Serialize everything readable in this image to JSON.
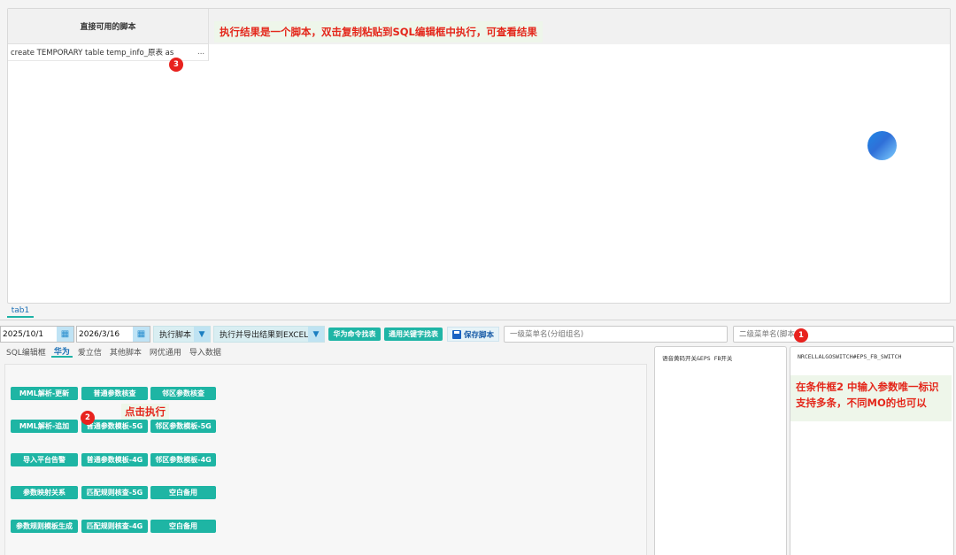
{
  "result": {
    "column_header": "直接可用的脚本",
    "rows": [
      {
        "text": "create TEMPORARY table temp_info_原表 as",
        "more": "..."
      }
    ],
    "tip": "执行结果是一个脚本，双击复制粘贴到SQL编辑框中执行，可查看结果"
  },
  "badges": {
    "one": "1",
    "two": "2",
    "three": "3"
  },
  "bottom_tab": "tab1",
  "toolbar": {
    "start_date": "2025/10/1",
    "end_date": "2026/3/16",
    "exec_script": "执行脚本",
    "exec_export": "执行并导出结果到EXCEL",
    "huawei_cmd": "华为命令找表",
    "common_keyword": "通用关键字找表",
    "save_script": "保存脚本",
    "level1_placeholder": "一级菜单名(分组组名)",
    "level2_placeholder": "二级菜单名(脚本"
  },
  "subtabs": [
    "SQL编辑框",
    "华为",
    "爱立信",
    "其他脚本",
    "网优通用",
    "导入数据"
  ],
  "active_subtab": "华为",
  "buttons": [
    [
      "MML解析-更新",
      "普通参数核查",
      "邻区参数核查"
    ],
    [
      "MML解析-追加",
      "普通参数模板-5G",
      "邻区参数模板-5G"
    ],
    [
      "导入平台告警",
      "普通参数模板-4G",
      "邻区参数模板-4G"
    ],
    [
      "参数映射关系",
      "匹配规则核查-5G",
      "空白备用"
    ],
    [
      "参数规则模板生成",
      "匹配规则核查-4G",
      "空白备用"
    ]
  ],
  "click_tip": "点击执行",
  "condition1": "语音黄码开关&EPS FB开关",
  "condition2": "NRCELLALGOSWITCH#EPS_FB_SWITCH",
  "condition_tip_line1": "在条件框2 中输入参数唯一标识",
  "condition_tip_line2": "支持多条，不同MO的也可以",
  "icons": [
    "calendar-icon",
    "dropdown-arrow-icon",
    "save-disk-icon",
    "loading-ball-icon"
  ]
}
